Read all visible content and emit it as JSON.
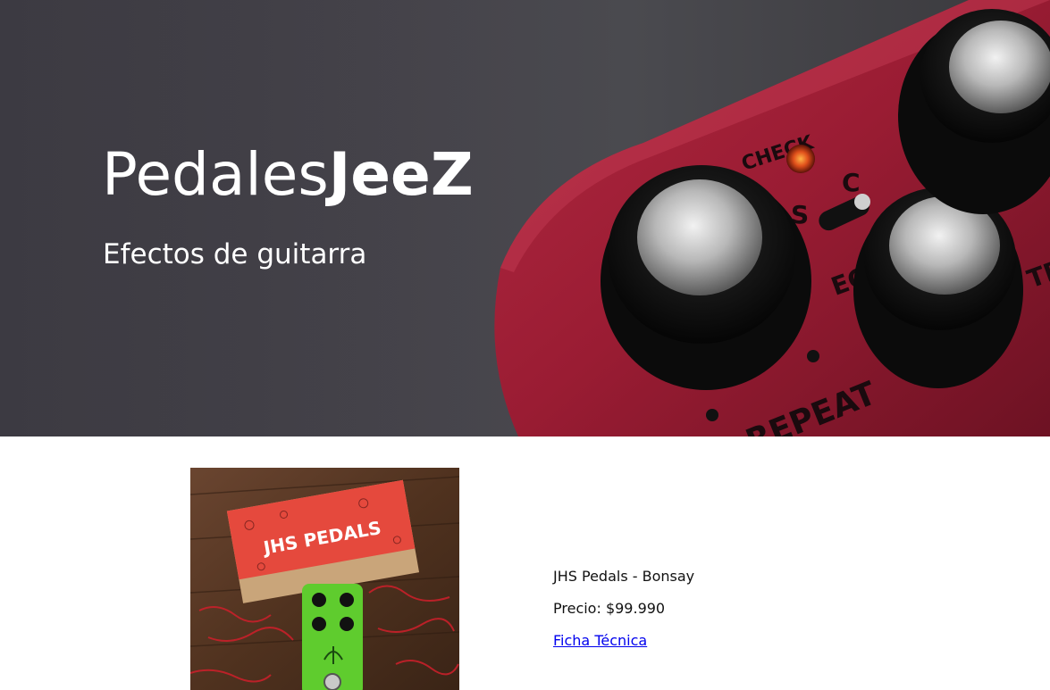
{
  "hero": {
    "title_regular": "Pedales",
    "title_bold": "JeeZ",
    "subtitle": "Efectos de guitarra",
    "pedal_labels": {
      "check": "CHECK",
      "s": "S",
      "c": "C",
      "ec": "EC",
      "repeat": "REPEAT",
      "rate": "TE",
      "tr": "TR"
    }
  },
  "product": {
    "image_box_label": "JHS PEDALS",
    "name": "JHS Pedals - Bonsay",
    "price_label": "Precio: $99.990",
    "datasheet_link": "Ficha Técnica"
  },
  "colors": {
    "hero_bg": "#3f3e44",
    "pedal_red": "#9e1f35",
    "link": "#0000ee"
  }
}
